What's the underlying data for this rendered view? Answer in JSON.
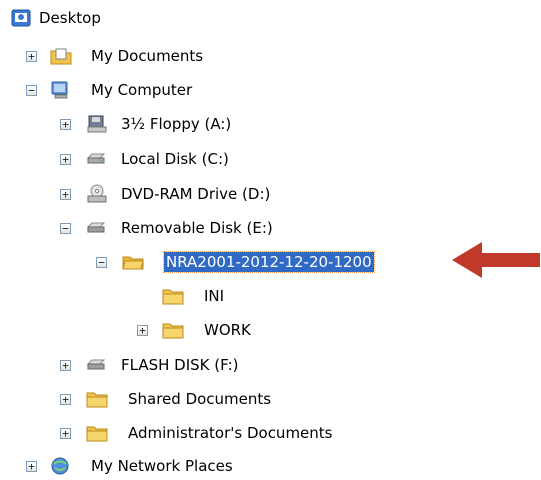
{
  "tree": {
    "desktop": "Desktop",
    "my_documents": "My Documents",
    "my_computer": "My Computer",
    "floppy": "3½ Floppy (A:)",
    "local_disk": "Local Disk (C:)",
    "dvd": "DVD-RAM Drive (D:)",
    "removable": "Removable Disk (E:)",
    "nra_folder": "NRA2001-2012-12-20-1200",
    "ini": "INI",
    "work": "WORK",
    "flash": "FLASH DISK (F:)",
    "shared_docs": "Shared Documents",
    "admin_docs": "Administrator's Documents",
    "network": "My Network Places"
  },
  "expanders": {
    "plus": "+",
    "minus": "−"
  },
  "colors": {
    "selection": "#316ac5",
    "arrow": "#c0392b",
    "folder": "#f2c44e"
  }
}
